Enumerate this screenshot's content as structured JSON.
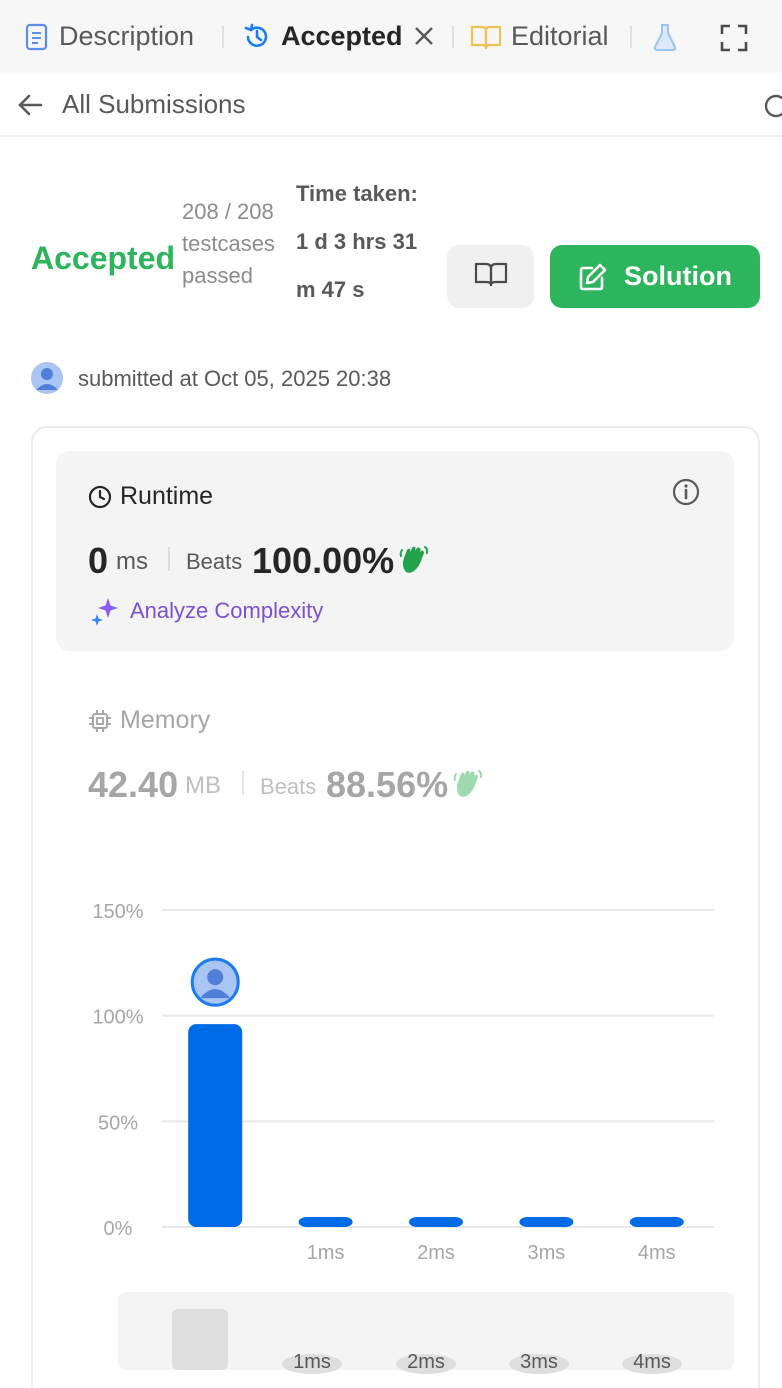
{
  "tabs": [
    {
      "label": "Description",
      "icon": "document-icon"
    },
    {
      "label": "Accepted",
      "icon": "history-icon",
      "active": true
    },
    {
      "label": "Editorial",
      "icon": "book-icon"
    },
    {
      "label": "",
      "icon": "flask-icon"
    }
  ],
  "nav": {
    "back_label": "All Submissions"
  },
  "summary": {
    "status": "Accepted",
    "testcases": "208 / 208 testcases passed",
    "time_taken": "Time taken: 1 d 3 hrs 31 m 47 s",
    "solution_label": "Solution",
    "submitted": "submitted at Oct 05, 2025 20:38"
  },
  "runtime": {
    "title": "Runtime",
    "value": "0",
    "unit": "ms",
    "beats_label": "Beats",
    "beats_pct": "100.00%",
    "analyze_label": "Analyze Complexity"
  },
  "memory": {
    "title": "Memory",
    "value": "42.40",
    "unit": "MB",
    "beats_label": "Beats",
    "beats_pct": "88.56%"
  },
  "colors": {
    "accepted": "#2db55d",
    "bar": "#006be6",
    "analyze": "#7b4fd6"
  },
  "chart_data": {
    "type": "bar",
    "title": "",
    "xlabel": "",
    "ylabel": "",
    "categories": [
      "",
      "1ms",
      "2ms",
      "3ms",
      "4ms"
    ],
    "values": [
      96,
      1,
      1,
      1,
      1
    ],
    "ylim": [
      0,
      150
    ],
    "yticks": [
      "0%",
      "50%",
      "100%",
      "150%"
    ],
    "grid": true,
    "overview_labels": [
      "1ms",
      "2ms",
      "3ms",
      "4ms"
    ]
  }
}
